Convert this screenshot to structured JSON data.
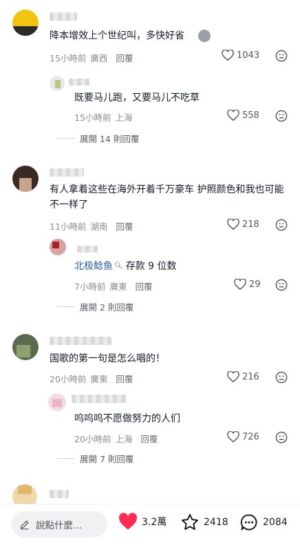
{
  "comments": [
    {
      "text": "降本增效上个世纪叫，多快好省",
      "time": "15小時前",
      "location": "廣西",
      "reply": "回覆",
      "likes": "1043",
      "replies": [
        {
          "text": "既要马儿跑，又要马儿不吃草",
          "time": "15小時前",
          "location": "上海",
          "likes": "558"
        }
      ],
      "expand": "展開 14 則回覆"
    },
    {
      "text": "有人拿着这些在海外开着千万豪车 护照颜色和我也可能不一样了",
      "time": "11小時前",
      "location": "湖南",
      "reply": "回覆",
      "likes": "218",
      "replies": [
        {
          "mention": "北极鲶鱼",
          "text": "存款 9 位数",
          "time": "7小時前",
          "location": "廣東",
          "likes": "29"
        }
      ],
      "expand": "展開 2 則回覆"
    },
    {
      "text": "国歌的第一句是怎么唱的！",
      "time": "20小時前",
      "location": "廣東",
      "reply": "回覆",
      "likes": "216",
      "replies": [
        {
          "text": "呜呜呜不愿做努力的人们",
          "time": "20小時前",
          "location": "上海",
          "likes": "726"
        }
      ],
      "expand": "展開 7 則回覆"
    }
  ],
  "reply_label": "回覆",
  "bottom_bar": {
    "input_placeholder": "說點什麼...",
    "like_count": "3.2萬",
    "favorite_count": "2418",
    "comment_count": "2084",
    "like_color": "#fe2c55"
  },
  "icons": {
    "input": "pencil-icon",
    "like": "heart-icon",
    "favorite": "star-icon",
    "comment": "comment-bubble-icon",
    "comment_like": "heart-outline-icon",
    "comment_dislike": "dislike-face-icon"
  }
}
